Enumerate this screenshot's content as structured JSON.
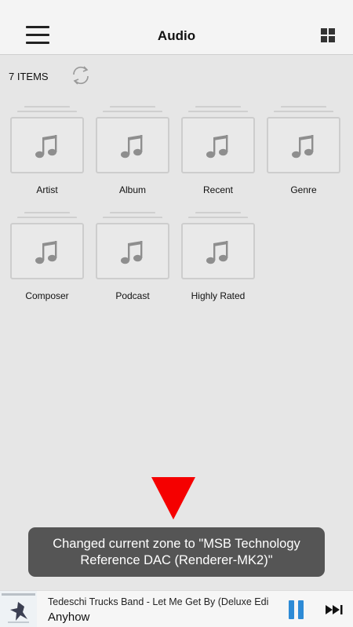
{
  "header": {
    "title": "Audio",
    "menu_icon": "hamburger-menu-icon",
    "view_icon": "grid-view-icon"
  },
  "toolbar": {
    "item_count": "7 ITEMS",
    "refresh_icon": "refresh-icon"
  },
  "categories": [
    {
      "label": "Artist",
      "icon": "music-note-icon"
    },
    {
      "label": "Album",
      "icon": "music-note-icon"
    },
    {
      "label": "Recent",
      "icon": "music-note-icon"
    },
    {
      "label": "Genre",
      "icon": "music-note-icon"
    },
    {
      "label": "Composer",
      "icon": "music-note-icon"
    },
    {
      "label": "Podcast",
      "icon": "music-note-icon"
    },
    {
      "label": "Highly Rated",
      "icon": "music-note-icon"
    }
  ],
  "toast": {
    "line1": "Changed current zone to \"MSB Technology",
    "line2": "Reference DAC (Renderer-MK2)\""
  },
  "now_playing": {
    "artist_album": "Tedeschi Trucks Band - Let Me Get By (Deluxe Edi",
    "track": "Anyhow",
    "pause_icon": "pause-icon",
    "next_icon": "skip-next-icon"
  },
  "colors": {
    "accent": "#2d8bd6",
    "indicator_arrow": "#f50000",
    "toast_bg": "#555555",
    "page_bg": "#e6e6e6"
  }
}
